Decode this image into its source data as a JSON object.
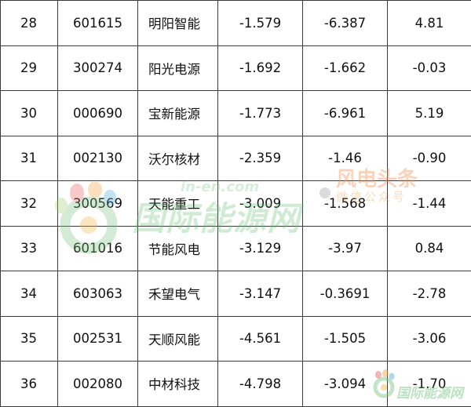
{
  "table": {
    "rows": [
      {
        "rank": "28",
        "code": "601615",
        "name": "明阳智能",
        "v1": "-1.579",
        "v2": "-6.387",
        "v3": "4.81"
      },
      {
        "rank": "29",
        "code": "300274",
        "name": "阳光电源",
        "v1": "-1.692",
        "v2": "-1.662",
        "v3": "-0.03"
      },
      {
        "rank": "30",
        "code": "000690",
        "name": "宝新能源",
        "v1": "-1.773",
        "v2": "-6.961",
        "v3": "5.19"
      },
      {
        "rank": "31",
        "code": "002130",
        "name": "沃尔核材",
        "v1": "-2.359",
        "v2": "-1.46",
        "v3": "-0.90"
      },
      {
        "rank": "32",
        "code": "300569",
        "name": "天能重工",
        "v1": "-3.009",
        "v2": "-1.568",
        "v3": "-1.44"
      },
      {
        "rank": "33",
        "code": "601016",
        "name": "节能风电",
        "v1": "-3.129",
        "v2": "-3.97",
        "v3": "0.84"
      },
      {
        "rank": "34",
        "code": "603063",
        "name": "禾望电气",
        "v1": "-3.147",
        "v2": "-0.3691",
        "v3": "-2.78"
      },
      {
        "rank": "35",
        "code": "002531",
        "name": "天顺风能",
        "v1": "-4.561",
        "v2": "-1.505",
        "v3": "-3.06"
      },
      {
        "rank": "36",
        "code": "002080",
        "name": "中材科技",
        "v1": "-4.798",
        "v2": "-3.094",
        "v3": "-1.70"
      }
    ]
  },
  "watermarks": {
    "main_logo_text": "国际能源网",
    "main_logo_url": "in-en.com",
    "wind_logo_text": "风电头条",
    "wind_logo_sub": "微信公众号",
    "corner_logo_text": "国际能源网"
  },
  "colors": {
    "border": "#3a3a3a",
    "text": "#111111",
    "watermark_green": "#55b868",
    "watermark_orange": "#f08a4b"
  }
}
